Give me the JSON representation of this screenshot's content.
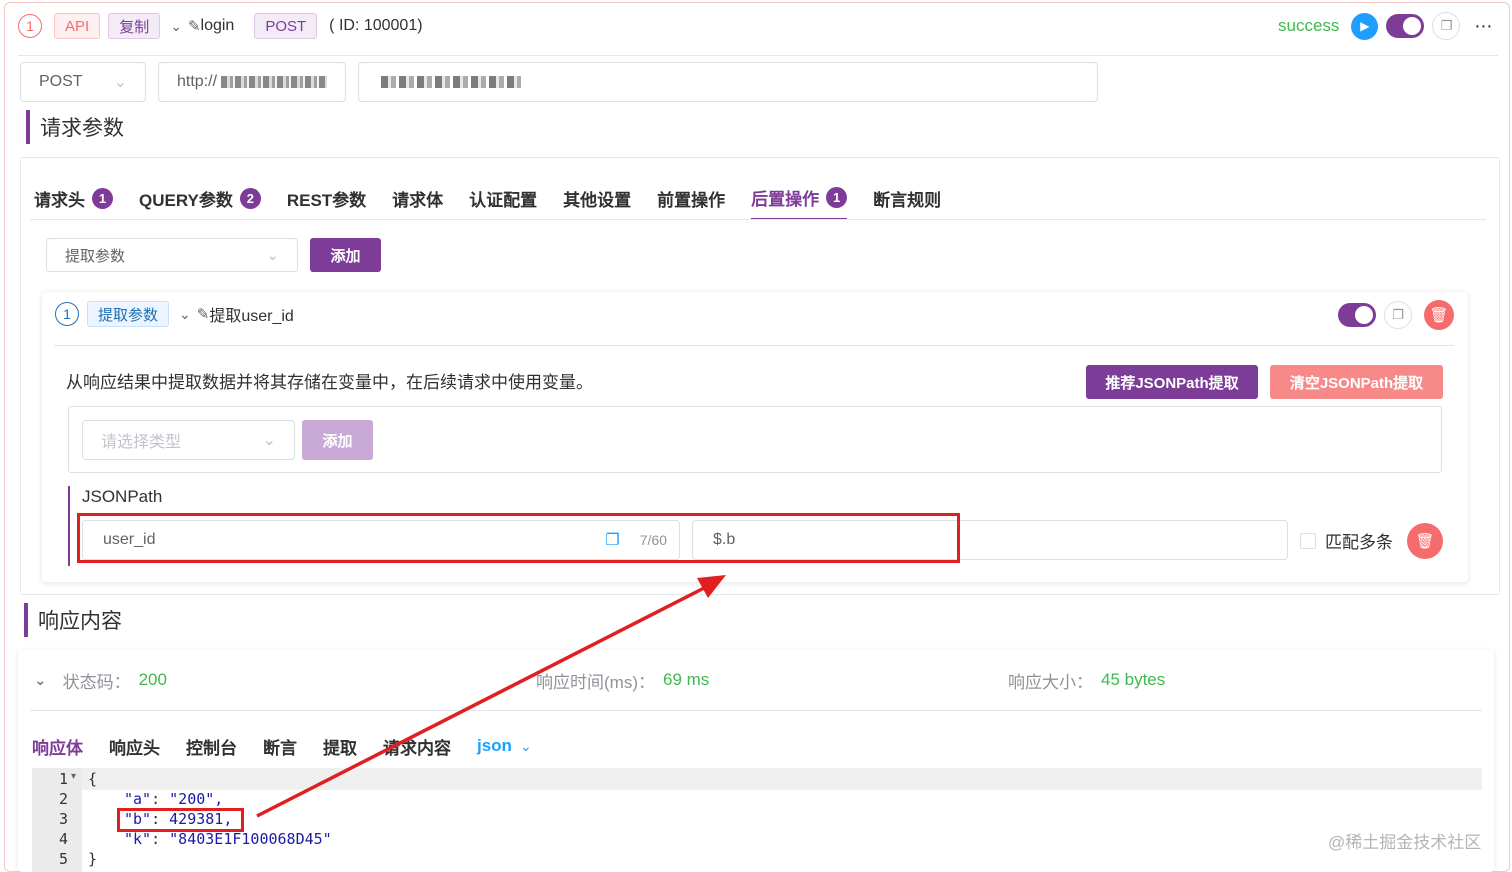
{
  "header": {
    "index": "1",
    "api_tag": "API",
    "copy_tag": "复制",
    "name": "login",
    "method_tag": "POST",
    "id_text": "( ID: 100001)",
    "status": "success"
  },
  "request_bar": {
    "method": "POST",
    "url_prefix": "http://",
    "url_path": ""
  },
  "request_params": {
    "title": "请求参数",
    "tabs": [
      {
        "label": "请求头",
        "badge": "1"
      },
      {
        "label": "QUERY参数",
        "badge": "2"
      },
      {
        "label": "REST参数"
      },
      {
        "label": "请求体"
      },
      {
        "label": "认证配置"
      },
      {
        "label": "其他设置"
      },
      {
        "label": "前置操作"
      },
      {
        "label": "后置操作",
        "badge": "1",
        "active": true
      },
      {
        "label": "断言规则"
      }
    ],
    "post_select": "提取参数",
    "add_button": "添加"
  },
  "extract_card": {
    "index": "1",
    "type_tag": "提取参数",
    "name": "提取user_id",
    "description": "从响应结果中提取数据并将其存储在变量中，在后续请求中使用变量。",
    "recommend_button": "推荐JSONPath提取",
    "clear_button": "清空JSONPath提取",
    "type_select_placeholder": "请选择类型",
    "type_add_button": "添加",
    "jsonpath_label": "JSONPath",
    "var_name": "user_id",
    "var_count": "7/60",
    "path_value": "$.b",
    "match_multi_label": "匹配多条"
  },
  "response": {
    "title": "响应内容",
    "status_label": "状态码：",
    "status_value": "200",
    "time_label": "响应时间(ms)：",
    "time_value": "69 ms",
    "size_label": "响应大小：",
    "size_value": "45 bytes",
    "tabs": [
      "响应体",
      "响应头",
      "控制台",
      "断言",
      "提取",
      "请求内容"
    ],
    "format": "json",
    "lines": [
      {
        "n": "1",
        "text": "{"
      },
      {
        "n": "2",
        "key": "\"a\"",
        "val": "\"200\","
      },
      {
        "n": "3",
        "key": "\"b\"",
        "val": "429381,"
      },
      {
        "n": "4",
        "key": "\"k\"",
        "val": "\"8403E1F100068D45\""
      },
      {
        "n": "5",
        "text": "}"
      }
    ]
  },
  "watermark": "@稀土掘金技术社区",
  "colors": {
    "accent": "#7d3c98",
    "danger": "#f56c6c",
    "success": "#3fb950",
    "annotation": "#e02020"
  }
}
